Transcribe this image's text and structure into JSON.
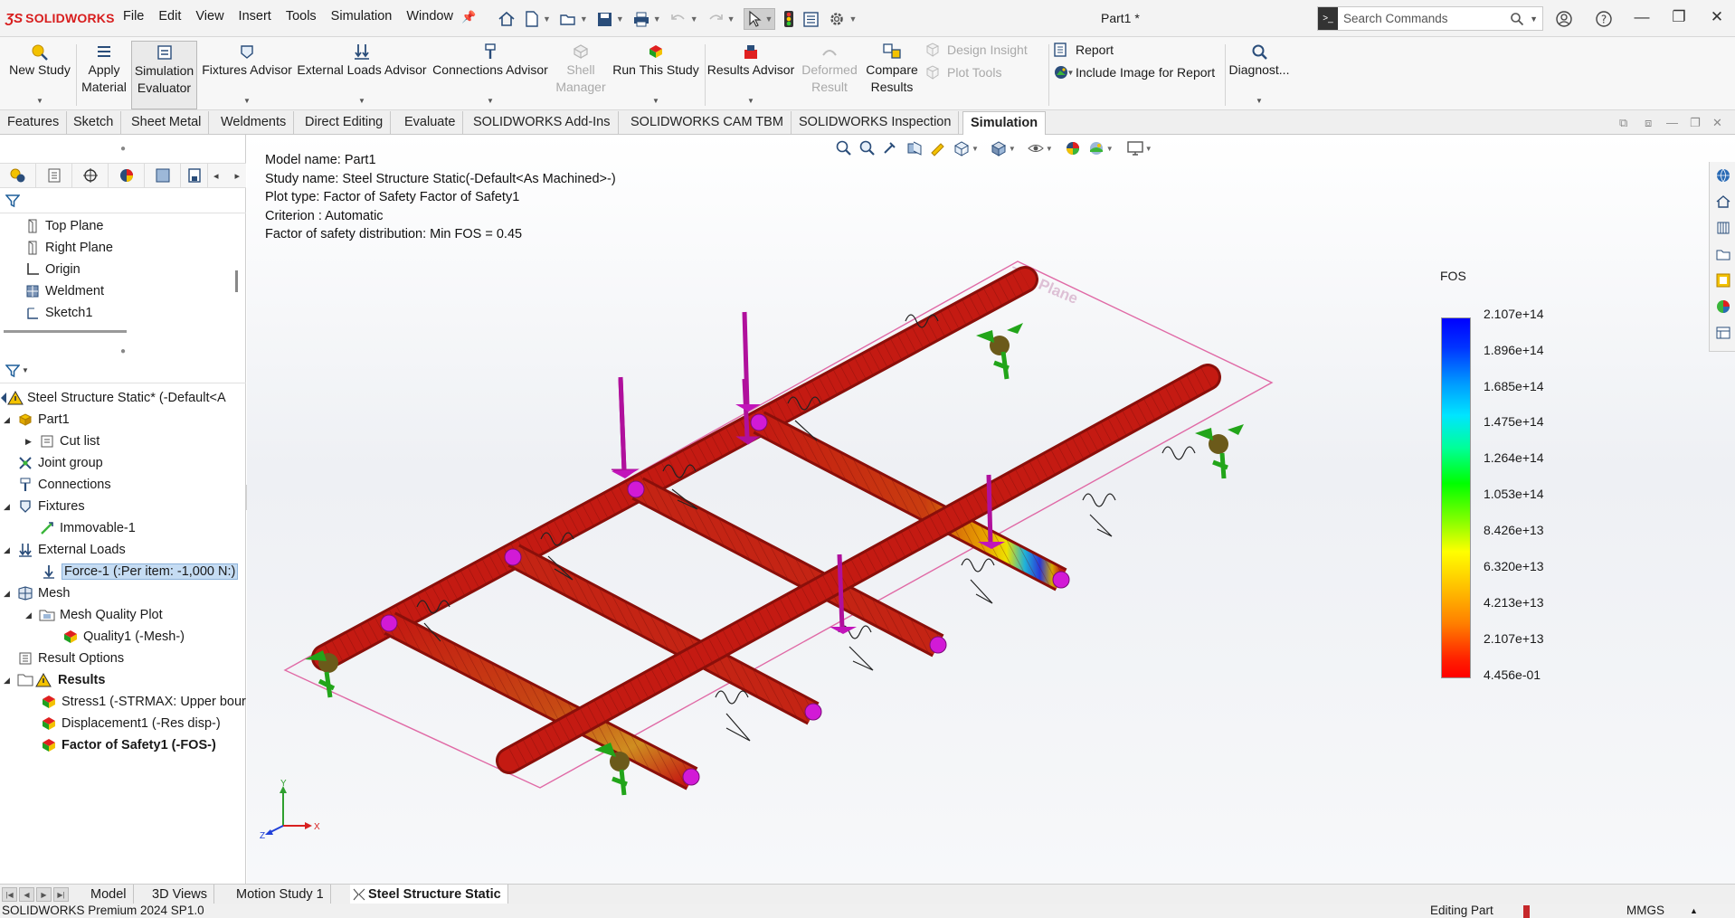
{
  "app": {
    "logo_brand": "SOLIDWORKS",
    "document_title": "Part1 *",
    "menu": [
      "File",
      "Edit",
      "View",
      "Insert",
      "Tools",
      "Simulation",
      "Window"
    ],
    "search_placeholder": "Search Commands"
  },
  "command_manager": {
    "new_study": "New Study",
    "apply_material": [
      "Apply",
      "Material"
    ],
    "simulation_evaluator": [
      "Simulation",
      "Evaluator"
    ],
    "fixtures_advisor": "Fixtures Advisor",
    "external_loads_advisor": "External Loads Advisor",
    "connections_advisor": "Connections Advisor",
    "shell_manager": [
      "Shell",
      "Manager"
    ],
    "run_this_study": "Run This Study",
    "results_advisor": "Results Advisor",
    "deformed_result": [
      "Deformed",
      "Result"
    ],
    "compare_results": [
      "Compare",
      "Results"
    ],
    "design_insight": "Design Insight",
    "plot_tools": "Plot Tools",
    "report": "Report",
    "include_image_for_report": "Include Image for Report",
    "diagnostics": "Diagnost..."
  },
  "tabs": [
    "Features",
    "Sketch",
    "Sheet Metal",
    "Weldments",
    "Direct Editing",
    "Evaluate",
    "SOLIDWORKS Add-Ins",
    "SOLIDWORKS CAM TBM",
    "SOLIDWORKS Inspection",
    "Simulation"
  ],
  "active_tab": "Simulation",
  "feature_tree": {
    "items": [
      "Top Plane",
      "Right Plane",
      "Origin",
      "Weldment",
      "Sketch1"
    ]
  },
  "study_tree": {
    "root": "Steel Structure Static* (-Default<A",
    "part": "Part1",
    "cut_list": "Cut list",
    "joint_group": "Joint group",
    "connections": "Connections",
    "fixtures": "Fixtures",
    "immovable": "Immovable-1",
    "external_loads": "External Loads",
    "force": "Force-1 (:Per item: -1,000 N:)",
    "mesh": "Mesh",
    "mesh_quality_plot": "Mesh Quality Plot",
    "quality1": "Quality1 (-Mesh-)",
    "result_options": "Result Options",
    "results": "Results",
    "stress": "Stress1 (-STRMAX: Upper bour",
    "displacement": "Displacement1 (-Res disp-)",
    "fos": "Factor of Safety1 (-FOS-)"
  },
  "plot_info": {
    "model_name": "Model name: Part1",
    "study_name": "Study name: Steel Structure Static(-Default<As Machined>-)",
    "plot_type": "Plot type: Factor of Safety Factor of Safety1",
    "criterion": "Criterion : Automatic",
    "distribution": "Factor of safety distribution: Min FOS = 0.45"
  },
  "legend": {
    "title": "FOS",
    "ticks": [
      "2.107e+14",
      "1.896e+14",
      "1.685e+14",
      "1.475e+14",
      "1.264e+14",
      "1.053e+14",
      "8.426e+13",
      "6.320e+13",
      "4.213e+13",
      "2.107e+13",
      "4.456e-01"
    ],
    "max_color": "#0000ff",
    "min_color": "#ff0000"
  },
  "model": {
    "plane_label": "Top Plane",
    "member_color": "#c41a12",
    "load_color": "#b0109c",
    "fixture_color": "#22a51a"
  },
  "triad": {
    "x": "X",
    "y": "Y",
    "z": "Z"
  },
  "bottom_tabs": [
    "Model",
    "3D Views",
    "Motion Study 1",
    "Steel Structure Static"
  ],
  "active_bottom_tab": "Steel Structure Static",
  "status": {
    "left": "SOLIDWORKS Premium 2024 SP1.0",
    "mode": "Editing Part",
    "units": "MMGS"
  }
}
